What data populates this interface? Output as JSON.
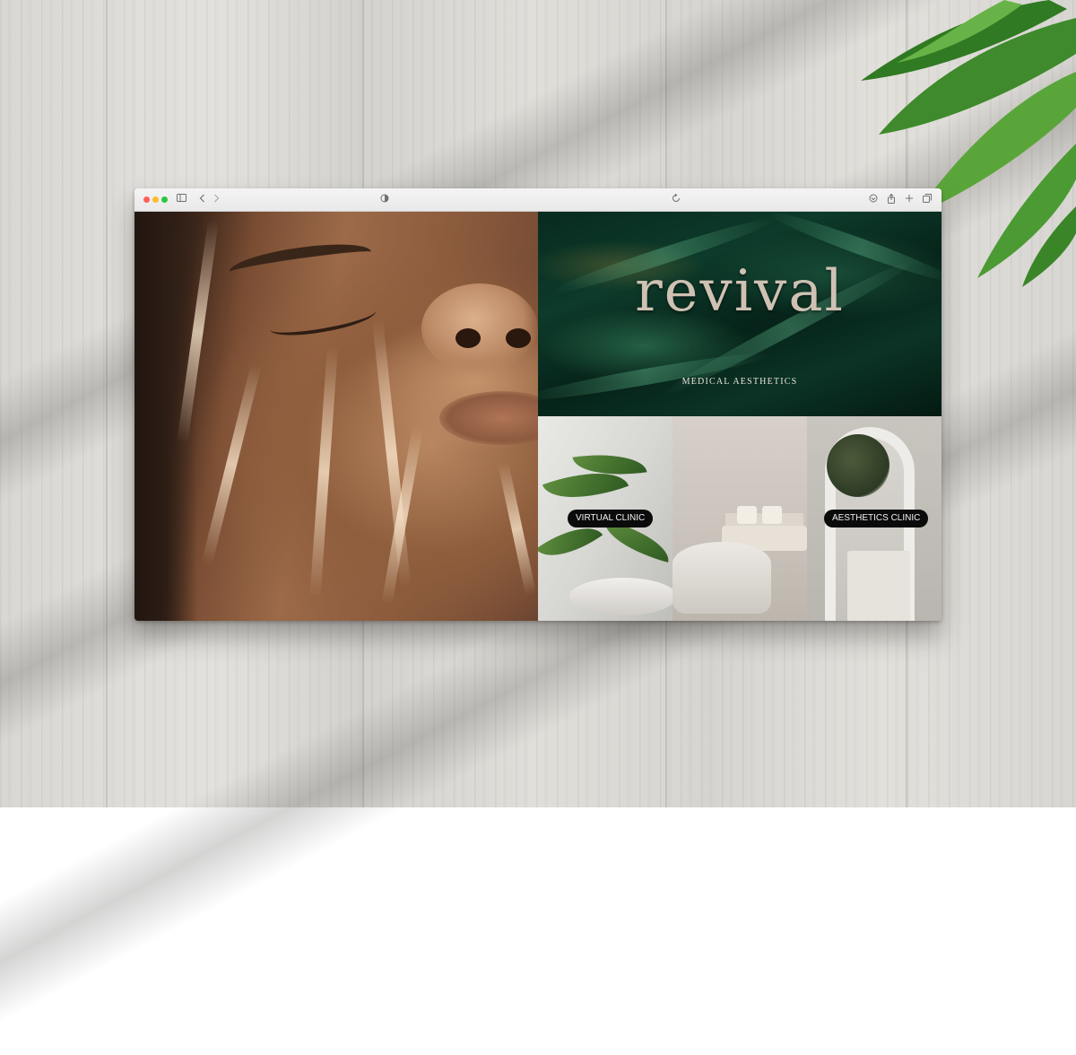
{
  "browser": {
    "window_controls": [
      "close",
      "minimize",
      "zoom"
    ],
    "icons": {
      "sidebar": "sidebar-icon",
      "back": "chevron-left-icon",
      "forward": "chevron-right-icon",
      "privacy": "privacy-shield-icon",
      "reload": "reload-icon",
      "downloads": "download-icon",
      "share": "share-icon",
      "new_tab": "plus-icon",
      "tabs": "tab-overview-icon"
    }
  },
  "site": {
    "brand": "revival",
    "tagline": "MEDICAL AESTHETICS",
    "tiles": [
      {
        "label": "VIRTUAL CLINIC"
      },
      {
        "label": "AESTHETICS CLINIC"
      }
    ]
  },
  "colors": {
    "brand_text": "#cfc1b3",
    "hero_green": "#0d3a2a",
    "pill_bg": "#0b0b0b",
    "pill_text": "#f2f2f2"
  }
}
